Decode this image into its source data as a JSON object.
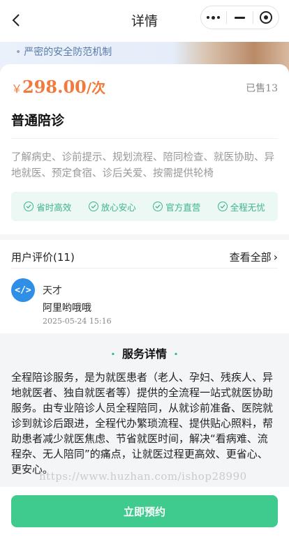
{
  "nav": {
    "title": "详情"
  },
  "banner": {
    "text": "严密的安全防范机制"
  },
  "product": {
    "currency": "￥",
    "price": "298.00",
    "unit": "/次",
    "sold": "已售13",
    "name": "普通陪诊",
    "description": "了解病史、诊前提示、规划流程、陪同检查、就医协助、异地就医、预定食宿、诊后关爱、按需提供轮椅",
    "features": [
      "省时高效",
      "放心安心",
      "官方直营",
      "全程无忧"
    ]
  },
  "reviews": {
    "title": "用户评价(11)",
    "view_all": "查看全部",
    "items": [
      {
        "avatar_text": "</>",
        "user": "天才",
        "text": "阿里哟哦哦",
        "time": "2025-05-24 15:16"
      }
    ]
  },
  "detail": {
    "title": "服务详情",
    "body": "全程陪诊服务，是为就医患者（老人、孕妇、残疾人、异地就医者、独自就医者等）提供的全流程一站式就医协助服务。由专业陪诊人员全程陪同，从就诊前准备、医院就诊到就诊后跟进，全程代办繁琐流程、提供贴心照料，帮助患者减少就医焦虑、节省就医时间，解决“看病难、流程杂、无人陪同”的痛点，让就医过程更高效、更省心、更安心。"
  },
  "watermark": "https://www.huzhan.com/ishop28990",
  "footer": {
    "book_label": "立即预约"
  },
  "colors": {
    "price": "#f27a3d",
    "accent_green": "#3ecb8d",
    "feature_text": "#3db58a",
    "feature_bg": "#ebf8f3"
  },
  "icons": {
    "back": "chevron-left-icon",
    "more": "more-dots-icon",
    "minimize": "minus-icon",
    "close": "target-circle-icon",
    "feature": "check-circle-icon",
    "view_all": "chevron-right-icon"
  }
}
